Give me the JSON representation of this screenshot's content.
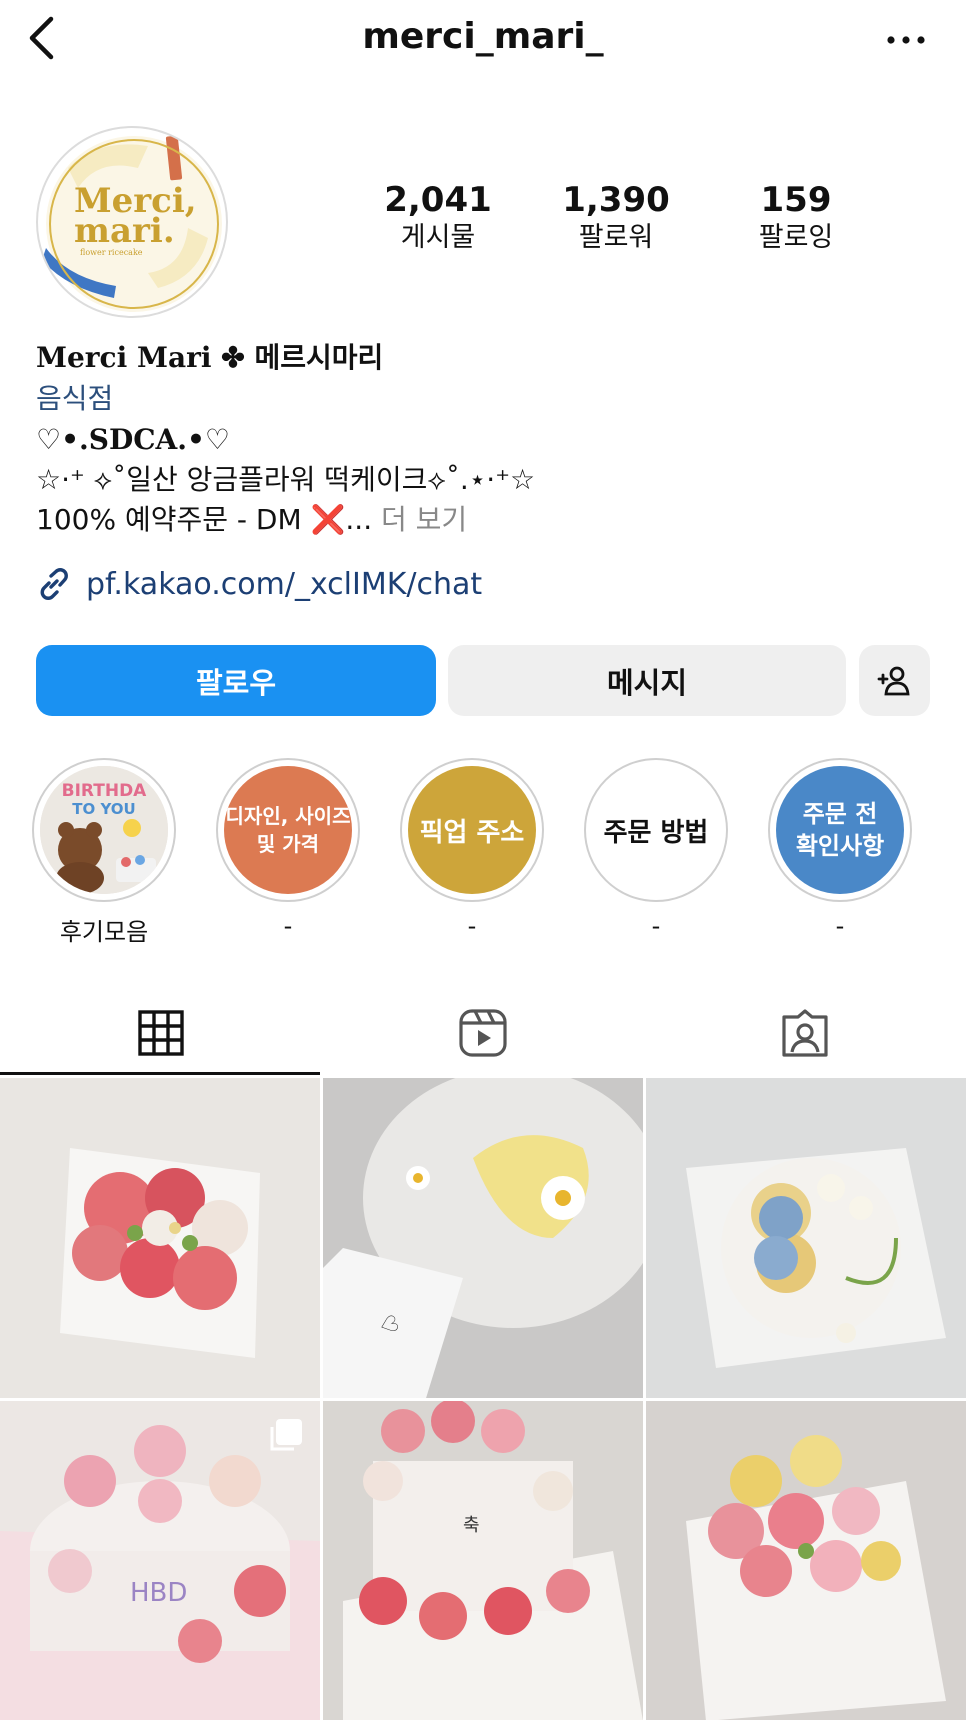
{
  "header": {
    "username": "merci_mari_",
    "back_icon": "chevron-left-icon",
    "more_icon": "more-horizontal-icon"
  },
  "profile": {
    "avatar_logo_line1": "Merci,",
    "avatar_logo_line2": "mari.",
    "avatar_logo_sub": "flower ricecake",
    "stats": [
      {
        "value": "2,041",
        "label": "게시물"
      },
      {
        "value": "1,390",
        "label": "팔로워"
      },
      {
        "value": "159",
        "label": "팔로잉"
      }
    ]
  },
  "bio": {
    "name_en": "Merci Mari ✤",
    "name_ko": "메르시마리",
    "category": "음식점",
    "line1": "♡•.SDCA.•♡",
    "line2": "☆·⁺ ⟡˚일산 앙금플라워 떡케이크⟡˚.⋆·⁺☆",
    "line3_prefix": "100% 예약주문 - DM",
    "line3_x": "❌",
    "line3_ellipsis": "...",
    "more": "더 보기",
    "link": "pf.kakao.com/_xclIMK/chat"
  },
  "actions": {
    "follow": "팔로우",
    "message": "메시지",
    "add_user_icon": "person-add-icon"
  },
  "highlights": [
    {
      "label": "후기모음",
      "cover_text": ""
    },
    {
      "label": "-",
      "cover_text": "디자인, 사이즈\n및 가격"
    },
    {
      "label": "-",
      "cover_text": "픽업 주소"
    },
    {
      "label": "-",
      "cover_text": "주문 방법"
    },
    {
      "label": "-",
      "cover_text": "주문 전\n확인사항"
    }
  ],
  "tabs": [
    {
      "icon": "grid-icon",
      "active": true
    },
    {
      "icon": "reels-icon",
      "active": false
    },
    {
      "icon": "tagged-icon",
      "active": false
    }
  ],
  "colors": {
    "follow_button": "#1a91f2",
    "secondary_button": "#efefef",
    "link": "#1c3f74",
    "highlight_orange": "#dc7a52",
    "highlight_gold": "#cda53a",
    "highlight_blue": "#4a88c8"
  }
}
